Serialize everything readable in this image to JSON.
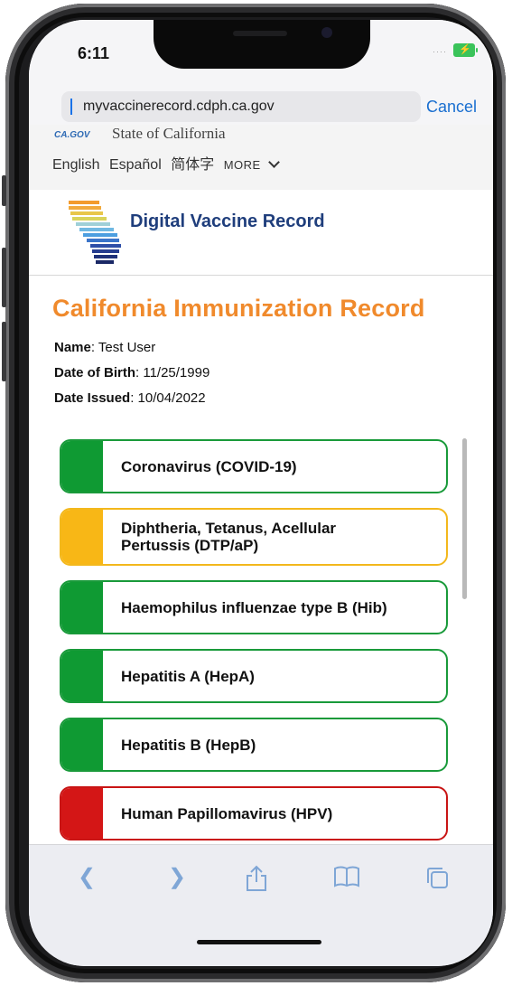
{
  "status": {
    "time": "6:11"
  },
  "browser": {
    "url": "myvaccinerecord.cdph.ca.gov",
    "cancel_label": "Cancel"
  },
  "gov_header": {
    "title": "State of California",
    "languages": [
      "English",
      "Español",
      "简体字",
      "MORE"
    ]
  },
  "brand": {
    "title": "Digital Vaccine Record"
  },
  "record": {
    "title": "California Immunization Record",
    "name_label": "Name",
    "name_value": ": Test User",
    "dob_label": "Date of Birth",
    "dob_value": ": 11/25/1999",
    "issued_label": "Date Issued",
    "issued_value": ": 10/04/2022"
  },
  "vaccines": [
    {
      "label": "Coronavirus (COVID-19)",
      "status_color": "#0f9a33"
    },
    {
      "label": "Diphtheria, Tetanus, Acellular Pertussis (DTP/aP)",
      "status_color": "#f8b716"
    },
    {
      "label": "Haemophilus influenzae type B (Hib)",
      "status_color": "#0f9a33"
    },
    {
      "label": "Hepatitis A (HepA)",
      "status_color": "#0f9a33"
    },
    {
      "label": "Hepatitis B (HepB)",
      "status_color": "#0f9a33"
    },
    {
      "label": "Human Papillomavirus (HPV)",
      "status_color": "#d41616"
    }
  ],
  "toolbar": {
    "icons": [
      "back-icon",
      "forward-icon",
      "share-icon",
      "bookmarks-icon",
      "tabs-icon"
    ]
  }
}
